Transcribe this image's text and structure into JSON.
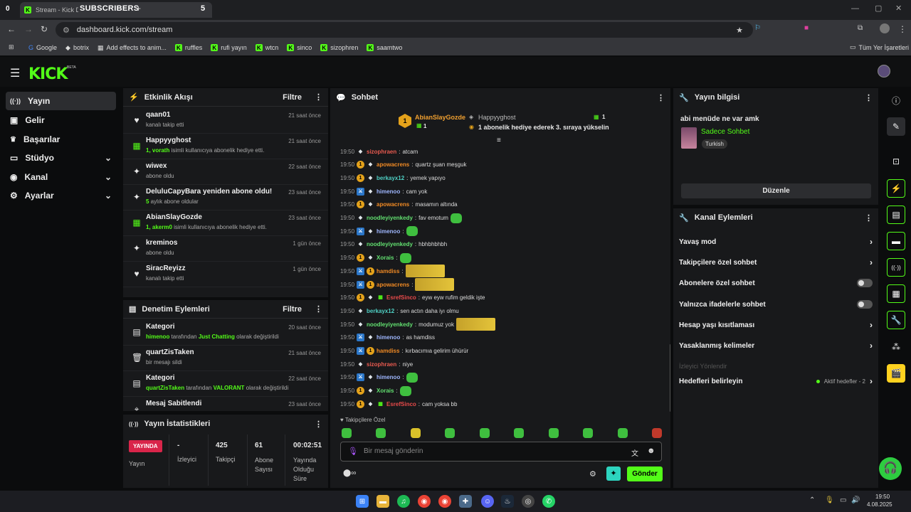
{
  "browser": {
    "tab_count_left": "0",
    "tab_title": "Stream - Kick Das",
    "overlay_label": "SUBSCRIBERS",
    "overlay_plus": "+",
    "overlay_count": "5",
    "url": "dashboard.kick.com/stream",
    "bookmarks": [
      "Google",
      "botrix",
      "Add effects to anim...",
      "ruffles",
      "rufi yayın",
      "wtcn",
      "sinco",
      "sizophren",
      "saamtwo"
    ],
    "bookmarks_right": "Tüm Yer İşaretleri"
  },
  "header": {
    "logo": "KICK",
    "logo_sup": "BETA"
  },
  "sidebar": {
    "items": [
      {
        "label": "Yayın",
        "icon": "broadcast-icon",
        "glyph": "((·))",
        "active": true
      },
      {
        "label": "Gelir",
        "icon": "revenue-icon",
        "glyph": "▣"
      },
      {
        "label": "Başarılar",
        "icon": "trophy-icon",
        "glyph": "🏆"
      },
      {
        "label": "Stüdyo",
        "icon": "studio-icon",
        "glyph": "▭",
        "chevron": "⌄"
      },
      {
        "label": "Kanal",
        "icon": "channel-icon",
        "glyph": "◉",
        "chevron": "⌄"
      },
      {
        "label": "Ayarlar",
        "icon": "settings-icon",
        "glyph": "⚙",
        "chevron": "⌄"
      }
    ]
  },
  "activity": {
    "title": "Etkinlik Akışı",
    "filter": "Filtre",
    "events": [
      {
        "icon": "♥",
        "name": "qaan01",
        "sub": "kanalı takip etti",
        "time": "21 saat önce"
      },
      {
        "icon": "▦",
        "name": "Happyyghost",
        "sub_b": "1, vorath",
        "sub": " isimli kullanıcıya abonelik hediye etti.",
        "time": "21 saat önce"
      },
      {
        "icon": "✦",
        "name": "wiwex",
        "sub": "abone oldu",
        "time": "22 saat önce"
      },
      {
        "icon": "✦",
        "name": "DeluluCapyBara yeniden abone oldu!",
        "sub_b": "5",
        "sub": " aylık abone oldular",
        "time": "23 saat önce"
      },
      {
        "icon": "▦",
        "name": "AbianSlayGozde",
        "sub_b": "1, akerm0",
        "sub": " isimli kullanıcıya abonelik hediye etti.",
        "time": "23 saat önce"
      },
      {
        "icon": "✦",
        "name": "kreminos",
        "sub": "abone oldu",
        "time": "1 gün önce"
      },
      {
        "icon": "♥",
        "name": "SiracReyizz",
        "sub": "kanalı takip etti",
        "time": "1 gün önce"
      }
    ]
  },
  "moderation": {
    "title": "Denetim Eylemleri",
    "filter": "Filtre",
    "events": [
      {
        "icon": "▤",
        "name": "Kategori",
        "sub_b": "himenoo",
        "sub": " tarafından ",
        "sub_b2": "Just Chatting",
        "sub2": " olarak değiştirildi",
        "time": "20 saat önce"
      },
      {
        "icon": "🗑",
        "name": "quartZisTaken",
        "sub": "bir mesajı sildi",
        "time": "21 saat önce"
      },
      {
        "icon": "▤",
        "name": "Kategori",
        "sub_b": "quartZisTaken",
        "sub": " tarafından ",
        "sub_b2": "VALORANT",
        "sub2": " olarak değiştirildi",
        "time": "22 saat önce"
      },
      {
        "icon": "⌖",
        "name": "Mesaj Sabitlendi",
        "sub": "",
        "time": "23 saat önce"
      }
    ]
  },
  "stats": {
    "title": "Yayın İstatistikleri",
    "live_badge": "YAYINDA",
    "live_label": "Yayın",
    "cols": [
      {
        "value": "-",
        "label": "İzleyici"
      },
      {
        "value": "425",
        "label": "Takipçi"
      },
      {
        "value": "61",
        "label": "Abone Sayısı"
      },
      {
        "value": "00:02:51",
        "label": "Yayında Olduğu Süre"
      }
    ]
  },
  "chat": {
    "title": "Sohbet",
    "top_gifter": {
      "name": "AbianSlayGozde",
      "count": "1",
      "rank": "1"
    },
    "second": {
      "name": "Happyyghost",
      "count": "1",
      "text": "1 abonelik hediye ederek 3. sıraya yükselin"
    },
    "messages": [
      {
        "time": "19:50",
        "badges": [
          "d"
        ],
        "user": "sizophraen",
        "color": "#e85a4f",
        "text": "atcam"
      },
      {
        "time": "19:50",
        "badges": [
          "g",
          "d"
        ],
        "user": "apowacrens",
        "color": "#f08a24",
        "text": "quartz şuan meşguk"
      },
      {
        "time": "19:50",
        "badges": [
          "g",
          "d"
        ],
        "user": "berkayx12",
        "color": "#4fd1c5",
        "text": "yemek yapıyo"
      },
      {
        "time": "19:50",
        "badges": [
          "b",
          "d"
        ],
        "user": "himenoo",
        "color": "#9fb7ff",
        "text": "cam yok"
      },
      {
        "time": "19:50",
        "badges": [
          "g",
          "d"
        ],
        "user": "apowacrens",
        "color": "#f08a24",
        "text": "masamın altında"
      },
      {
        "time": "19:50",
        "badges": [
          "d"
        ],
        "user": "noodleyiyenkedy",
        "color": "#62e070",
        "text": "fav emotum",
        "emote": true
      },
      {
        "time": "19:50",
        "badges": [
          "b",
          "d"
        ],
        "user": "himenoo",
        "color": "#9fb7ff",
        "text": "",
        "emote": true
      },
      {
        "time": "19:50",
        "badges": [
          "d"
        ],
        "user": "noodleyiyenkedy",
        "color": "#62e070",
        "text": "hbhbhbhbh"
      },
      {
        "time": "19:50",
        "badges": [
          "g",
          "d"
        ],
        "user": "Xorais",
        "color": "#62e070",
        "text": "",
        "emote": true
      },
      {
        "time": "19:50",
        "badges": [
          "b",
          "g"
        ],
        "user": "hamdiss",
        "color": "#f08a24",
        "text": "",
        "bigemote": true
      },
      {
        "time": "19:50",
        "badges": [
          "b",
          "g"
        ],
        "user": "apowacrens",
        "color": "#f08a24",
        "text": "",
        "bigemote": true
      },
      {
        "time": "19:50",
        "badges": [
          "g",
          "d",
          "s"
        ],
        "user": "EsrefSinco",
        "color": "#e84a4a",
        "text": "eyw eyw rufim geldik işte"
      },
      {
        "time": "19:50",
        "badges": [
          "d"
        ],
        "user": "berkayx12",
        "color": "#4fd1c5",
        "text": "sen actın daha iyı olmu"
      },
      {
        "time": "19:50",
        "badges": [
          "d"
        ],
        "user": "noodleyiyenkedy",
        "color": "#62e070",
        "text": "modumuz yok",
        "bigemote": true
      },
      {
        "time": "19:50",
        "badges": [
          "b",
          "d"
        ],
        "user": "himenoo",
        "color": "#9fb7ff",
        "text": "as hamdiss"
      },
      {
        "time": "19:50",
        "badges": [
          "b",
          "g"
        ],
        "user": "hamdiss",
        "color": "#f08a24",
        "text": "kırbacımıa gelirim ühürür"
      },
      {
        "time": "19:50",
        "badges": [
          "d"
        ],
        "user": "sizophraen",
        "color": "#e85a4f",
        "text": "niye"
      },
      {
        "time": "19:50",
        "badges": [
          "b",
          "d"
        ],
        "user": "himenoo",
        "color": "#9fb7ff",
        "text": "",
        "emote": true
      },
      {
        "time": "19:50",
        "badges": [
          "g",
          "d"
        ],
        "user": "Xorais",
        "color": "#62e070",
        "text": "",
        "emote": true
      },
      {
        "time": "19:50",
        "badges": [
          "g",
          "d",
          "s"
        ],
        "user": "EsrefSinco",
        "color": "#e84a4a",
        "text": "cam yoksa bb"
      }
    ],
    "followers_only": "Takipçilere Özel",
    "placeholder": "Bir mesaj gönderin",
    "send": "Gönder"
  },
  "stream_info": {
    "title": "Yayın bilgisi",
    "stream_title": "abi menüde ne var amk",
    "category": "Sadece Sohbet",
    "tag": "Turkish",
    "edit": "Düzenle"
  },
  "channel_actions": {
    "title": "Kanal Eylemleri",
    "items": [
      {
        "label": "Yavaş mod",
        "type": "chevron"
      },
      {
        "label": "Takipçilere özel sohbet",
        "type": "chevron"
      },
      {
        "label": "Abonelere özel sohbet",
        "type": "toggle"
      },
      {
        "label": "Yalnızca ifadelerle sohbet",
        "type": "toggle"
      },
      {
        "label": "Hesap yaşı kısıtlaması",
        "type": "chevron"
      },
      {
        "label": "Yasaklanmış kelimeler",
        "type": "chevron"
      },
      {
        "label": "İzleyici Yönlendir",
        "type": "disabled"
      },
      {
        "label": "Hedefleri belirleyin",
        "type": "chevron",
        "extra": "Aktif hedefler - 2"
      }
    ]
  },
  "taskbar": {
    "time": "19:50",
    "date": "4.08.2025"
  },
  "colors": {
    "accent": "#53fc18",
    "panel": "#18191b",
    "live": "#d9254a"
  }
}
